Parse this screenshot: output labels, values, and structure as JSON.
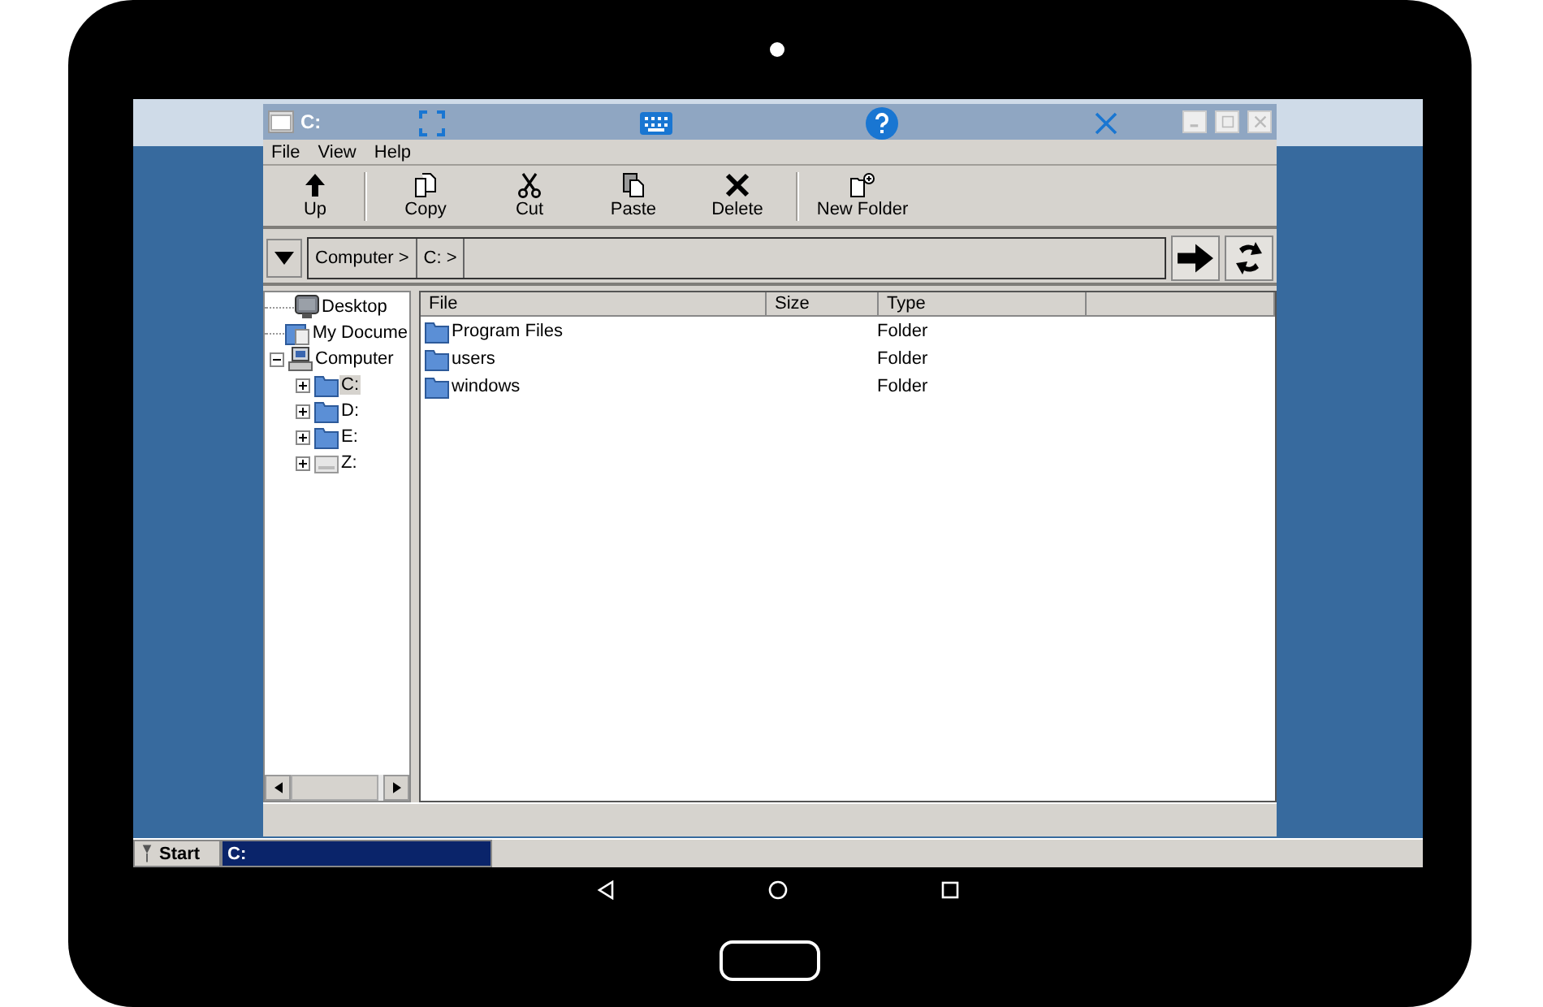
{
  "window": {
    "title": "C:"
  },
  "menu": [
    "File",
    "View",
    "Help"
  ],
  "toolbar": [
    {
      "label": "Up",
      "kind": "up"
    },
    {
      "label": "Copy",
      "kind": "copy"
    },
    {
      "label": "Cut",
      "kind": "cut"
    },
    {
      "label": "Paste",
      "kind": "paste"
    },
    {
      "label": "Delete",
      "kind": "delete"
    },
    {
      "label": "New Folder",
      "kind": "new-folder"
    }
  ],
  "address": {
    "crumbs": [
      "Computer >",
      "C: >"
    ]
  },
  "tree": [
    {
      "label": "Desktop",
      "kind": "desktop",
      "selected": false
    },
    {
      "label": "My Docume",
      "kind": "documents",
      "selected": false
    },
    {
      "label": "Computer",
      "kind": "computer",
      "selected": false,
      "expanded": true,
      "children": [
        {
          "label": "C:",
          "kind": "drive",
          "selected": true,
          "expanded": false
        },
        {
          "label": "D:",
          "kind": "drive",
          "selected": false,
          "expanded": false
        },
        {
          "label": "E:",
          "kind": "drive",
          "selected": false,
          "expanded": false
        },
        {
          "label": "Z:",
          "kind": "network-drive",
          "selected": false,
          "expanded": false
        }
      ]
    }
  ],
  "table": {
    "columns": [
      "File",
      "Size",
      "Type"
    ],
    "rows": [
      {
        "name": "Program Files",
        "type": "Folder"
      },
      {
        "name": "users",
        "type": "Folder"
      },
      {
        "name": "windows",
        "type": "Folder"
      }
    ]
  },
  "taskbar": {
    "start": "Start",
    "tasks": [
      {
        "label": "C:",
        "selected": true
      }
    ]
  }
}
